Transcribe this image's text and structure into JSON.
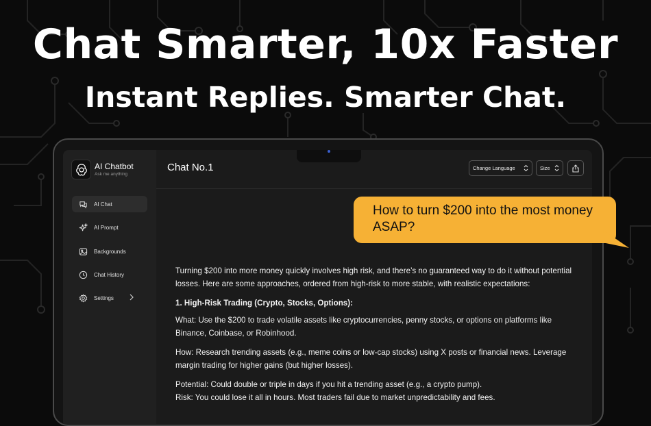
{
  "hero": {
    "title": "Chat Smarter, 10x Faster",
    "subtitle": "Instant Replies. Smarter Chat."
  },
  "app": {
    "name": "AI Chatbot",
    "tagline": "Ask me anything"
  },
  "sidebar": {
    "items": [
      {
        "label": "AI Chat",
        "icon": "chat-bubbles-icon",
        "active": true
      },
      {
        "label": "AI Prompt",
        "icon": "sparkles-icon",
        "active": false
      },
      {
        "label": "Backgrounds",
        "icon": "image-icon",
        "active": false
      },
      {
        "label": "Chat History",
        "icon": "clock-icon",
        "active": false
      },
      {
        "label": "Settings",
        "icon": "gear-icon",
        "active": false
      }
    ]
  },
  "header": {
    "title": "Chat No.1",
    "language_label": "Change Language",
    "size_label": "Size",
    "share_icon": "share-icon"
  },
  "bubble": {
    "text": "How to turn $200 into the most money ASAP?",
    "color": "#f6b135"
  },
  "answer": {
    "intro": "Turning $200 into more money quickly involves high risk, and there’s no guaranteed way to do it without potential losses. Here are some approaches, ordered from high-risk to more stable, with realistic expectations:",
    "heading": "1. High-Risk Trading (Crypto, Stocks, Options):",
    "what": "What: Use the $200 to trade volatile assets like cryptocurrencies, penny stocks, or options on platforms like Binance, Coinbase, or Robinhood.",
    "how": "How: Research trending assets (e.g., meme coins or low-cap stocks) using X posts or financial news. Leverage margin trading for higher gains (but higher losses).",
    "potential": "Potential: Could double or triple in days if you hit a trending asset (e.g., a crypto pump).",
    "risk": "Risk: You could lose it all in hours. Most traders fail due to market unpredictability and fees."
  }
}
